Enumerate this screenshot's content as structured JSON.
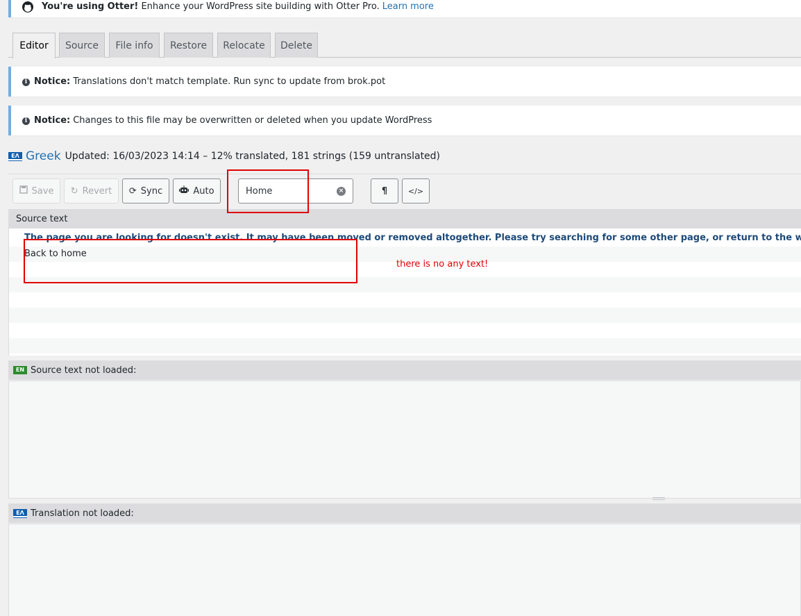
{
  "promo": {
    "brand": "You're using Otter!",
    "message": "Enhance your WordPress site building with Otter Pro.",
    "link": "Learn more"
  },
  "tabs": [
    {
      "label": "Editor",
      "active": true
    },
    {
      "label": "Source"
    },
    {
      "label": "File info"
    },
    {
      "label": "Restore"
    },
    {
      "label": "Relocate"
    },
    {
      "label": "Delete"
    }
  ],
  "notices": [
    {
      "label": "Notice:",
      "text": "Translations don't match template. Run sync to update from brok.pot"
    },
    {
      "label": "Notice:",
      "text": "Changes to this file may be overwritten or deleted when you update WordPress"
    }
  ],
  "language": {
    "flag": "EΛ",
    "name": "Greek",
    "meta": "Updated: 16/03/2023 14:14 – 12% translated, 181 strings (159 untranslated)"
  },
  "toolbar": {
    "save": "Save",
    "revert": "Revert",
    "sync": "Sync",
    "auto": "Auto",
    "search_value": "Home",
    "pilcrow": "¶",
    "code": "</>"
  },
  "source_list": {
    "header": "Source text",
    "rows": [
      "The page you are looking for doesn't exist. It may have been moved or removed altogether. Please try searching for some other page, or return to the website's homepage",
      "Back to home"
    ]
  },
  "source_panel": {
    "flag": "EN",
    "label": "Source text not loaded:"
  },
  "translation_panel": {
    "flag": "EΛ",
    "label": "Translation not loaded:"
  },
  "annotation": "there is no any text!",
  "colors": {
    "accent": "#2271b1",
    "notice_border": "#72aee6",
    "annotation": "#e00000"
  }
}
